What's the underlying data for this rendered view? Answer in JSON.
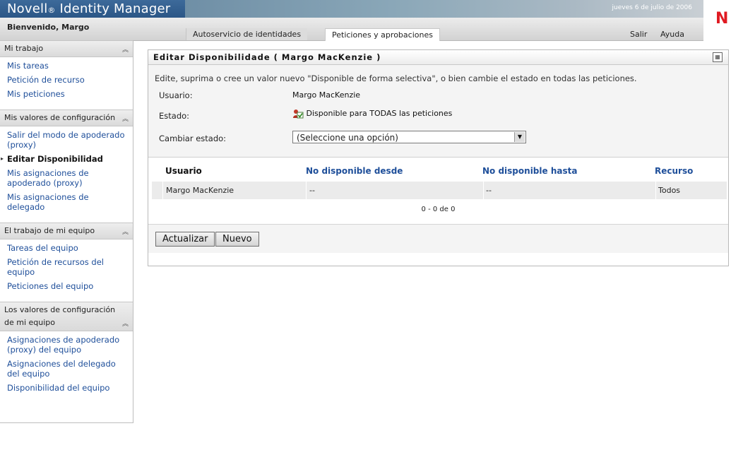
{
  "header": {
    "brand": "Novell",
    "brand_reg": "®",
    "product": " Identity Manager",
    "date": "jueves 6 de julio de 2006",
    "welcome": "Bienvenido, Margo",
    "tabs": [
      {
        "label": "Autoservicio de identidades"
      },
      {
        "label": "Peticiones y aprobaciones"
      }
    ],
    "links": {
      "logout": "Salir",
      "help": "Ayuda"
    },
    "logo_letter": "N",
    "logo_color": "#e01a22"
  },
  "sidebar": {
    "sections": [
      {
        "title": "Mi trabajo",
        "items": [
          "Mis tareas",
          "Petición de recurso",
          "Mis peticiones"
        ]
      },
      {
        "title": "Mis valores de configuración",
        "items": [
          "Salir del modo de apoderado (proxy)",
          "Editar Disponibilidad",
          "Mis asignaciones de apoderado (proxy)",
          "Mis asignaciones de delegado"
        ]
      },
      {
        "title": "El trabajo de mi equipo",
        "items": [
          "Tareas del equipo",
          "Petición de recursos del equipo",
          "Peticiones del equipo"
        ]
      },
      {
        "title": "Los valores de configuración de mi equipo",
        "items": [
          "Asignaciones de apoderado (proxy) del equipo",
          "Asignaciones del delegado del equipo",
          "Disponibilidad del equipo"
        ]
      }
    ]
  },
  "panel": {
    "title": "Editar Disponibilidade ( Margo MacKenzie )",
    "intro": "Edite, suprima o cree un valor nuevo \"Disponible de forma selectiva\", o bien cambie el estado en todas las peticiones.",
    "user_label": "Usuario:",
    "user_value": "Margo MacKenzie",
    "status_label": "Estado:",
    "status_value": "Disponible para TODAS las peticiones",
    "change_label": "Cambiar estado:",
    "select_value": "(Seleccione una opción)",
    "table": {
      "headers": [
        "Usuario",
        "No disponible desde",
        "No disponible hasta",
        "Recurso"
      ],
      "rows": [
        [
          "Margo MacKenzie",
          "--",
          "--",
          "Todos"
        ]
      ],
      "pager": "0 - 0 de 0"
    },
    "buttons": {
      "update": "Actualizar",
      "new": "Nuevo"
    }
  }
}
